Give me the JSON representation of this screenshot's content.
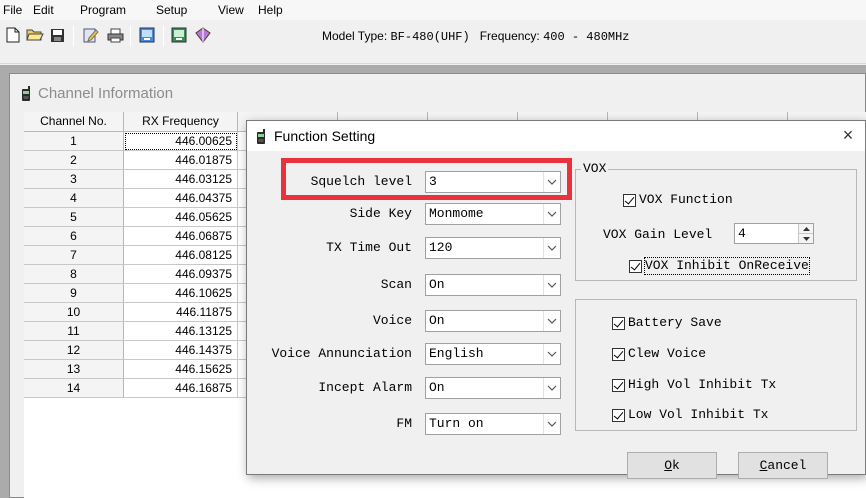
{
  "menu": [
    {
      "label": "File"
    },
    {
      "label": "Edit"
    },
    {
      "label": "Program"
    },
    {
      "label": "Setup"
    },
    {
      "label": "View"
    },
    {
      "label": "Help"
    }
  ],
  "toolbar": {
    "model_type_label": "Model Type: ",
    "model_type_value": "BF-480(UHF)",
    "frequency_label": "Frequency: ",
    "frequency_value": "400 - 480MHz",
    "icons": [
      "new-file-icon",
      "open-folder-icon",
      "save-icon",
      "edit-icon",
      "print-icon",
      "read-radio-icon",
      "write-radio-icon",
      "about-icon"
    ]
  },
  "channel_window": {
    "title": "Channel Information",
    "columns": [
      "Channel No.",
      "RX Frequency"
    ],
    "rows": [
      {
        "no": "1",
        "rx": "446.00625"
      },
      {
        "no": "2",
        "rx": "446.01875"
      },
      {
        "no": "3",
        "rx": "446.03125"
      },
      {
        "no": "4",
        "rx": "446.04375"
      },
      {
        "no": "5",
        "rx": "446.05625"
      },
      {
        "no": "6",
        "rx": "446.06875"
      },
      {
        "no": "7",
        "rx": "446.08125"
      },
      {
        "no": "8",
        "rx": "446.09375"
      },
      {
        "no": "9",
        "rx": "446.10625"
      },
      {
        "no": "10",
        "rx": "446.11875"
      },
      {
        "no": "11",
        "rx": "446.13125"
      },
      {
        "no": "12",
        "rx": "446.14375"
      },
      {
        "no": "13",
        "rx": "446.15625"
      },
      {
        "no": "14",
        "rx": "446.16875"
      }
    ]
  },
  "dialog": {
    "title": "Function Setting",
    "close_label": "×",
    "fields": {
      "squelch": {
        "label": "Squelch level",
        "value": "3"
      },
      "side_key": {
        "label": "Side Key",
        "value": "Monmome"
      },
      "tx_timeout": {
        "label": "TX Time Out",
        "value": "120"
      },
      "scan": {
        "label": "Scan",
        "value": "On"
      },
      "voice": {
        "label": "Voice",
        "value": "On"
      },
      "voice_annunciation": {
        "label": "Voice Annunciation",
        "value": "English"
      },
      "incept_alarm": {
        "label": "Incept Alarm",
        "value": "On"
      },
      "fm": {
        "label": "FM",
        "value": "Turn on"
      }
    },
    "vox": {
      "group_label": "VOX",
      "vox_function": "VOX Function",
      "gain_label": "VOX Gain Level",
      "gain_value": "4",
      "inhibit": "VOX Inhibit OnReceive"
    },
    "options": {
      "battery_save": "Battery Save",
      "clew_voice": "Clew Voice",
      "high_vol": "High Vol Inhibit Tx",
      "low_vol": "Low Vol Inhibit Tx"
    },
    "buttons": {
      "ok_hot": "O",
      "ok_rest": "k",
      "cancel_hot": "C",
      "cancel_rest": "ancel"
    }
  }
}
